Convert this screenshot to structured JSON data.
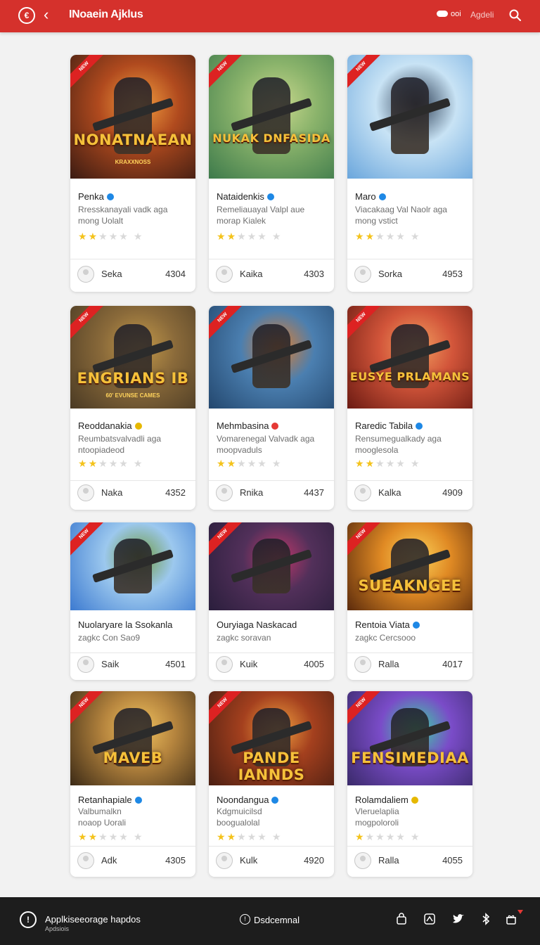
{
  "header": {
    "title": "INoaein Ajklus",
    "mode_label": "ooi",
    "extra_label": "Agdeli",
    "colors": {
      "bar": "#d5312c"
    }
  },
  "cards": [
    {
      "name": "Penka",
      "badge": "blue",
      "desc1": "Rresskanayali vadk aga",
      "desc2": "mong Uolalt",
      "stars": 2,
      "user": "Seka",
      "count": "4304",
      "thumb": {
        "banner": "NONATNAEAN",
        "sub": "KRAXXNOSS",
        "colors": [
          "#3b1b12",
          "#b04a1e",
          "#f4a040"
        ],
        "ribbon": "NEW"
      }
    },
    {
      "name": "Nataidenkis",
      "badge": "blue",
      "desc1": "Remeliauayal Valpl aue",
      "desc2": "morap Kialek",
      "stars": 2,
      "user": "Kaika",
      "count": "4303",
      "thumb": {
        "banner": "NUKAK DNFASIDA",
        "sub": "",
        "colors": [
          "#3d7a4b",
          "#8ab36b",
          "#c9d88d"
        ],
        "ribbon": "NEW"
      }
    },
    {
      "name": "Maro",
      "badge": "blue",
      "desc1": "Viacakaag Val Naolr aga",
      "desc2": "mong vstict",
      "stars": 2,
      "user": "Sorka",
      "count": "4953",
      "thumb": {
        "banner": "",
        "sub": "",
        "colors": [
          "#6aa6dc",
          "#c8e3f5",
          "#2a3b52"
        ],
        "ribbon": "NEW"
      }
    },
    {
      "name": "Reoddanakia",
      "badge": "gold",
      "desc1": "Reumbatsvalvadli aga",
      "desc2": "ntoopiadeod",
      "stars": 2,
      "user": "Naka",
      "count": "4352",
      "thumb": {
        "banner": "ENGRIANS IB",
        "sub": "60' EVUNSE CAMES",
        "colors": [
          "#4a3a24",
          "#8a6a3a",
          "#c49a4a"
        ],
        "ribbon": "NEW"
      }
    },
    {
      "name": "Mehmbasina",
      "badge": "red",
      "desc1": "Vomarenegal Valvadk aga",
      "desc2": "moopvaduls",
      "stars": 2,
      "user": "Rnika",
      "count": "4437",
      "thumb": {
        "banner": "",
        "sub": "",
        "colors": [
          "#23476e",
          "#4b7fb0",
          "#e07d2c"
        ],
        "ribbon": "NEW"
      }
    },
    {
      "name": "Raredic Tabila",
      "badge": "blue",
      "desc1": "Rensumegualkady aga",
      "desc2": "mooglesola",
      "stars": 2,
      "user": "Kalka",
      "count": "4909",
      "thumb": {
        "banner": "EUSYE PRLAMANS",
        "sub": "",
        "colors": [
          "#6b1a12",
          "#d2553a",
          "#f2a060"
        ],
        "ribbon": "NEW"
      }
    },
    {
      "name": "Nuolaryare la Ssokanla",
      "badge": "",
      "desc1": "zagkc Con Sao9",
      "desc2": "",
      "stars": 0,
      "user": "Saik",
      "count": "4501",
      "thumb": {
        "banner": "",
        "sub": "",
        "colors": [
          "#3c7ad0",
          "#9cc8ee",
          "#6f9a3e"
        ],
        "ribbon": "NEW"
      }
    },
    {
      "name": "Ouryiaga Naskacad",
      "badge": "",
      "desc1": "zagkc soravan",
      "desc2": "",
      "stars": 0,
      "user": "Kuik",
      "count": "4005",
      "thumb": {
        "banner": "",
        "sub": "",
        "colors": [
          "#2a1e3c",
          "#52305a",
          "#c2386a"
        ],
        "ribbon": "NEW"
      }
    },
    {
      "name": "Rentoia Viata",
      "badge": "blue",
      "desc1": "zagkc Cercsooo",
      "desc2": "",
      "stars": 0,
      "user": "Ralla",
      "count": "4017",
      "thumb": {
        "banner": "SUEAKNGEE",
        "sub": "",
        "colors": [
          "#5a2a0c",
          "#e08a24",
          "#fbd35a"
        ],
        "ribbon": "NEW"
      }
    },
    {
      "name": "Retanhapiale",
      "badge": "blue",
      "desc1": "Valbumalkn",
      "desc2": "noaop Uorali",
      "stars": 2,
      "user": "Adk",
      "count": "4305",
      "thumb": {
        "banner": "MAVEB",
        "sub": "",
        "colors": [
          "#3b2a16",
          "#b6853e",
          "#f2c460"
        ],
        "ribbon": "NEW"
      }
    },
    {
      "name": "Noondangua",
      "badge": "blue",
      "desc1": "Kdgmuicilsd",
      "desc2": "boogualolal",
      "stars": 2,
      "user": "Kulk",
      "count": "4920",
      "thumb": {
        "banner": "PANDE IANNDS",
        "sub": "",
        "colors": [
          "#4a1e12",
          "#a4401e",
          "#f0a040"
        ],
        "ribbon": "NEW"
      }
    },
    {
      "name": "Rolamdaliem",
      "badge": "gold",
      "desc1": "Vleruelaplia",
      "desc2": "mogpoloroli",
      "stars": 1,
      "user": "Ralla",
      "count": "4055",
      "thumb": {
        "banner": "FENSIMEDIAA",
        "sub": "",
        "colors": [
          "#3a2a6a",
          "#7a4cc8",
          "#38d6a0"
        ],
        "ribbon": "NEW"
      }
    }
  ],
  "footer": {
    "title": "Applkiseeorage hapdos",
    "subtitle": "Apdsiois",
    "mid_label": "Dsdcemnal",
    "colors": {
      "bar": "#1d1d1d",
      "dot": "#e53935"
    }
  }
}
